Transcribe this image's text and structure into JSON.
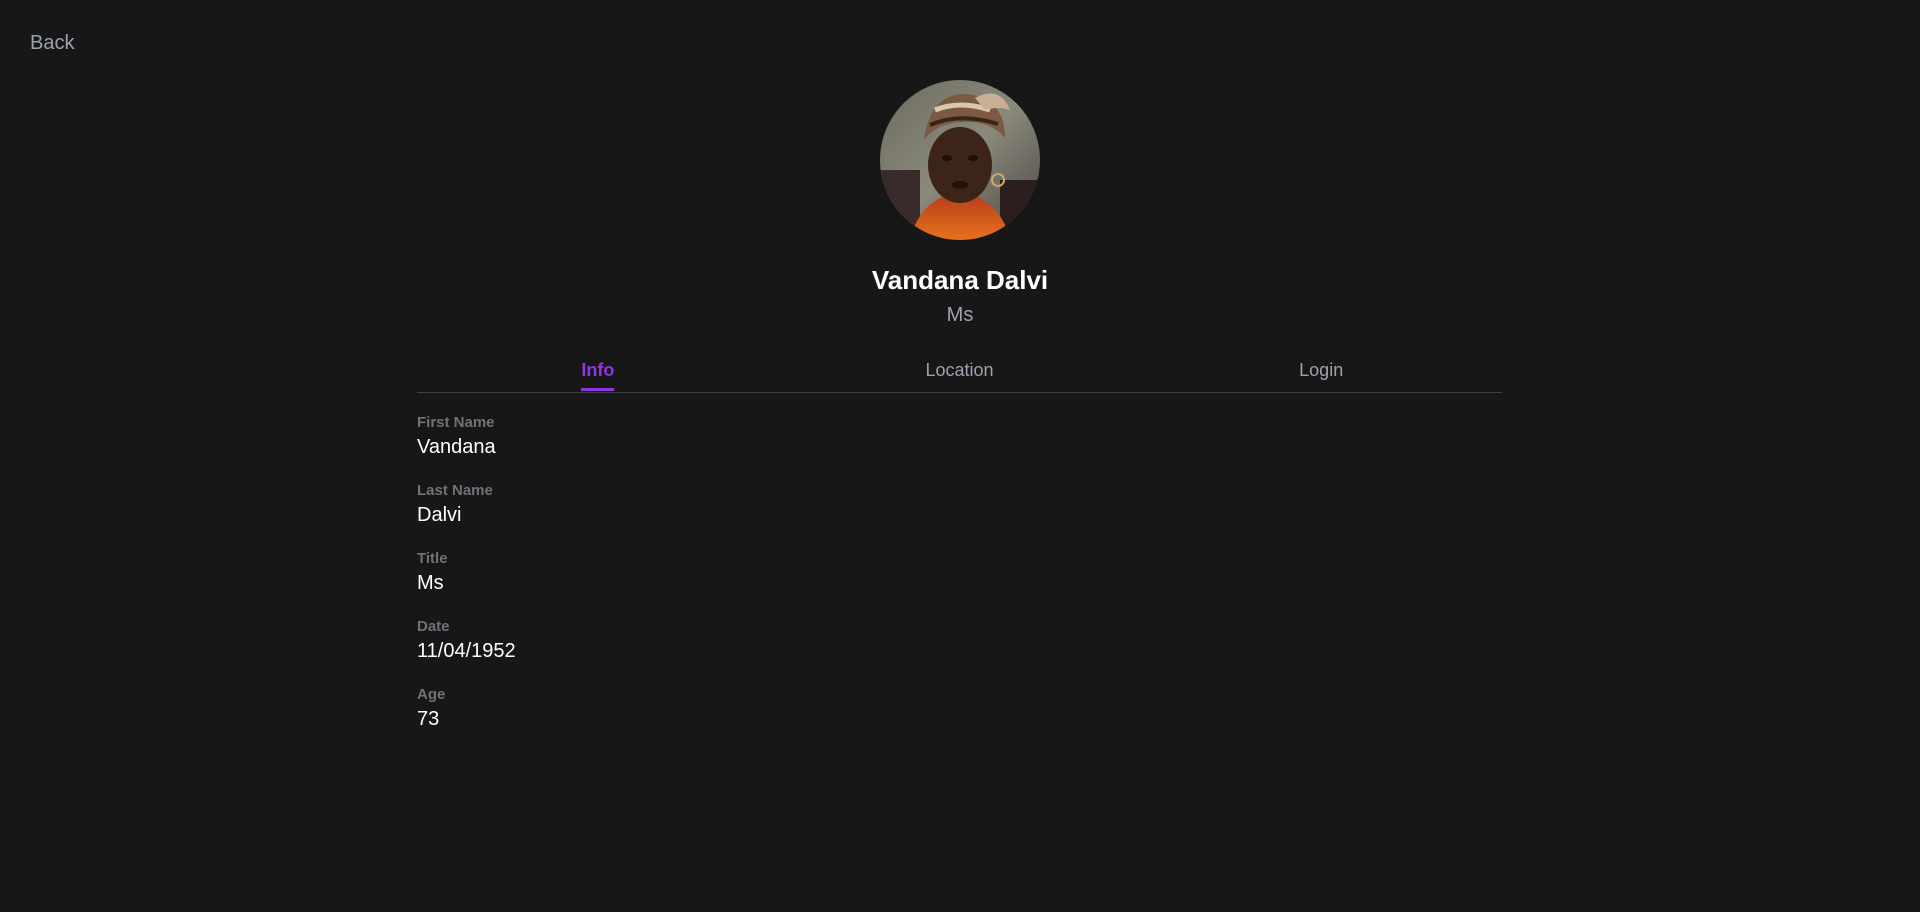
{
  "nav": {
    "back_label": "Back"
  },
  "profile": {
    "name": "Vandana Dalvi",
    "title": "Ms",
    "avatar_icon": "user-photo"
  },
  "tabs": [
    {
      "label": "Info",
      "active": true
    },
    {
      "label": "Location",
      "active": false
    },
    {
      "label": "Login",
      "active": false
    }
  ],
  "info": {
    "fields": [
      {
        "label": "First Name",
        "value": "Vandana"
      },
      {
        "label": "Last Name",
        "value": "Dalvi"
      },
      {
        "label": "Title",
        "value": "Ms"
      },
      {
        "label": "Date",
        "value": "11/04/1952"
      },
      {
        "label": "Age",
        "value": "73"
      }
    ]
  },
  "colors": {
    "background": "#171717",
    "accent": "#9333ea",
    "muted_text": "#9ca3af",
    "label_text": "#71717a",
    "divider": "#3f3f46"
  }
}
